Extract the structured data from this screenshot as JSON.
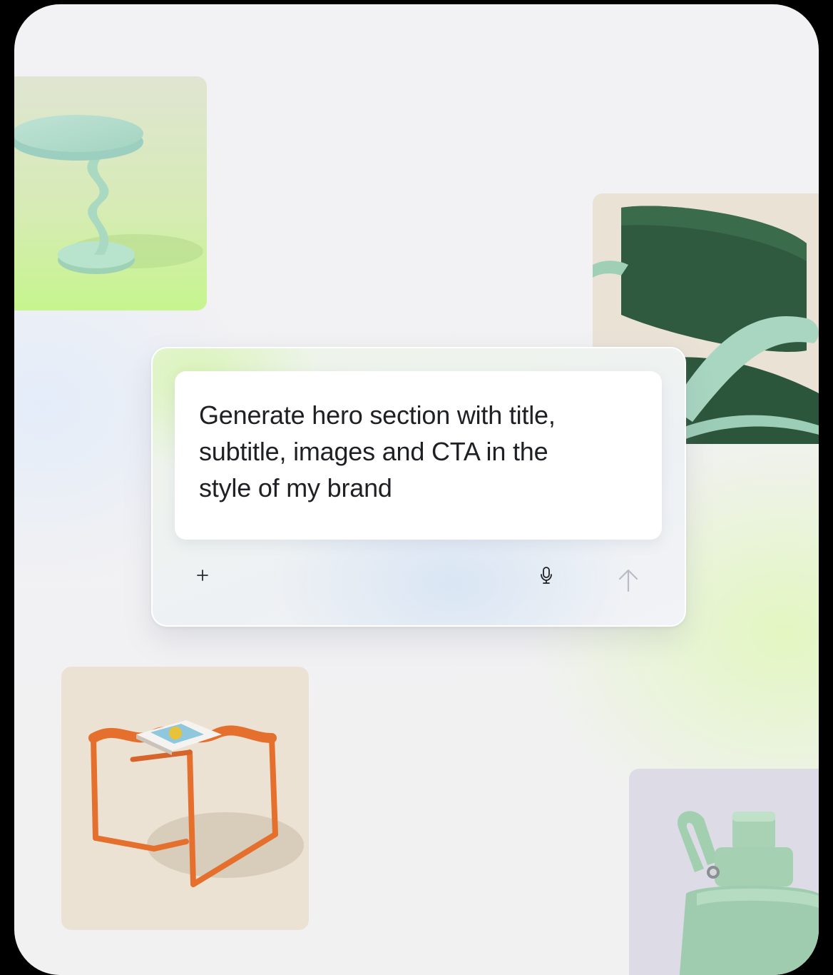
{
  "prompt": {
    "text": "Generate hero section with title, subtitle, images and CTA in the style of my brand"
  },
  "toolbar": {
    "add_icon": "plus-icon",
    "voice_icon": "microphone-icon",
    "send_icon": "arrow-up-icon"
  },
  "images": [
    {
      "subject": "side-table"
    },
    {
      "subject": "armchair"
    },
    {
      "subject": "stool"
    },
    {
      "subject": "water-bottle"
    }
  ],
  "colors": {
    "page_background": "#f1f1f3",
    "card_accent_green": "#d6f3b0",
    "card_accent_blue": "#d7e4f4",
    "text": "#1f2024",
    "send_disabled": "#b9bcc4"
  }
}
